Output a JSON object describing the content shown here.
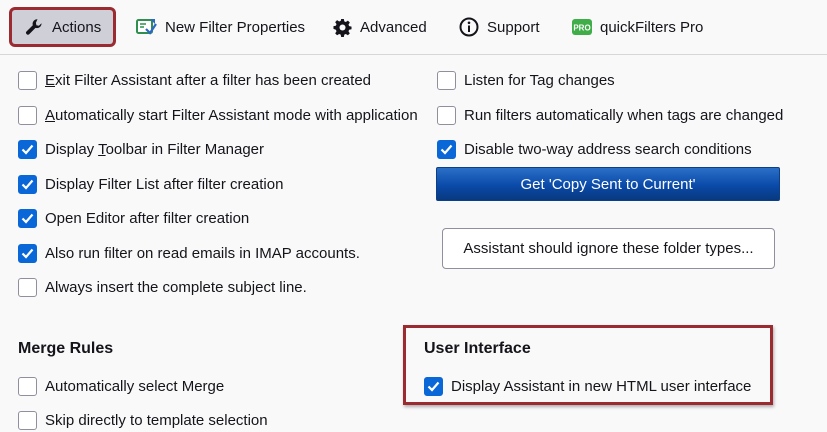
{
  "tabs": [
    {
      "label": "Actions",
      "icon": "wrench-icon",
      "active": true
    },
    {
      "label": "New Filter Properties",
      "icon": "filter-properties-icon"
    },
    {
      "label": "Advanced",
      "icon": "gear-icon"
    },
    {
      "label": "Support",
      "icon": "info-icon"
    },
    {
      "label": "quickFilters Pro",
      "icon": "pro-badge-icon"
    }
  ],
  "pro_badge_text": "PRO",
  "left_options": {
    "exit_assistant": {
      "before": "",
      "key": "E",
      "after": "xit Filter Assistant after a filter has been created",
      "checked": false
    },
    "auto_start": {
      "before": "",
      "key": "A",
      "after": "utomatically start Filter Assistant mode with application",
      "checked": false
    },
    "display_toolbar": {
      "before": "Display ",
      "key": "T",
      "after": "oolbar in Filter Manager",
      "checked": true
    },
    "display_filter_list": {
      "before": "Display Filter List after filter creation",
      "key": "",
      "after": "",
      "checked": true
    },
    "open_editor": {
      "before": "Open Editor after filter creation",
      "key": "",
      "after": "",
      "checked": true
    },
    "run_imap": {
      "before": "Also run filter on read emails in IMAP accounts.",
      "key": "",
      "after": "",
      "checked": true
    },
    "insert_subject": {
      "before": "Always insert the complete subject line.",
      "key": "",
      "after": "",
      "checked": false
    }
  },
  "right_options": {
    "listen_tags": {
      "before": "Listen for Tag changes",
      "key": "",
      "after": "",
      "checked": false
    },
    "run_on_tags": {
      "before": "Run filters automatically when tags are changed",
      "key": "",
      "after": "",
      "checked": false
    },
    "disable_two_way": {
      "before": "Disable two-way address search conditions",
      "key": "",
      "after": "",
      "checked": true
    }
  },
  "buttons": {
    "copy_sent": "Get 'Copy Sent to Current'",
    "ignore_folders": "Assistant should ignore these folder types..."
  },
  "merge_rules": {
    "heading": "Merge Rules",
    "auto_merge": {
      "label": "Automatically select Merge",
      "checked": false
    },
    "skip_template": {
      "label": "Skip directly to template selection",
      "checked": false
    }
  },
  "user_interface": {
    "heading": "User Interface",
    "html_ui": {
      "label": "Display Assistant in new HTML user interface",
      "checked": true
    }
  },
  "colors": {
    "accent": "#0a67d8",
    "highlight_border": "#9b2a31",
    "primary_button": "#0a4aa8",
    "pro_badge": "#3fae49"
  }
}
